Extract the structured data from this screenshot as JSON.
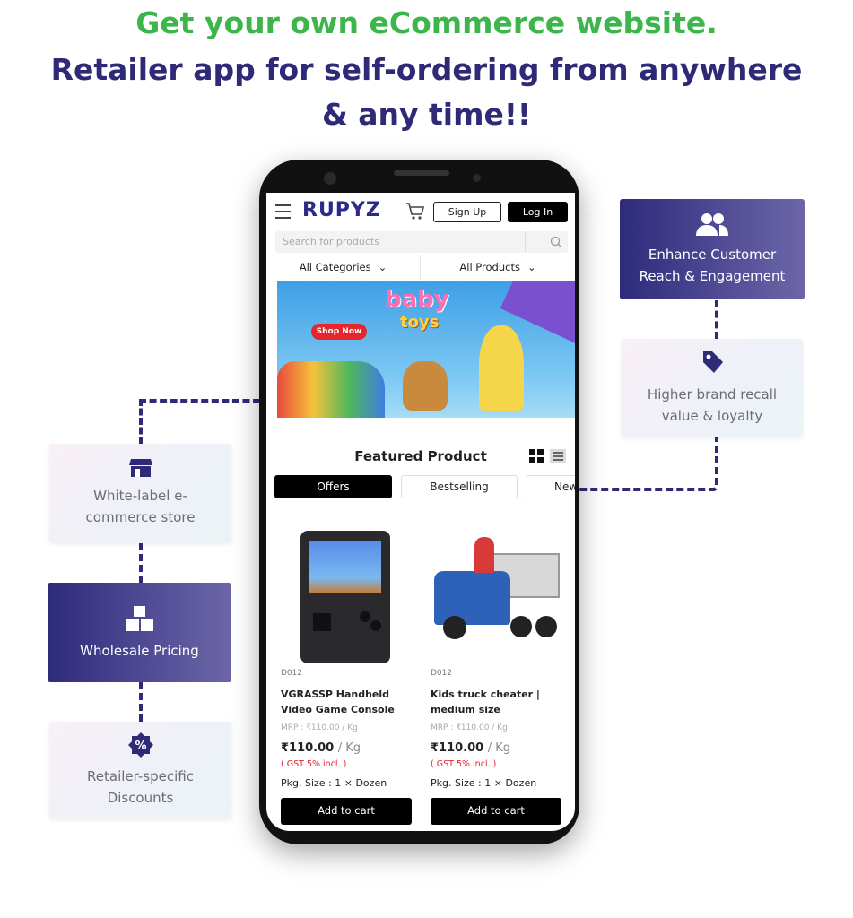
{
  "headline": {
    "line1": "Get your own eCommerce website.",
    "line2": "Retailer app for self-ordering from anywhere",
    "line3": "& any time!!"
  },
  "colors": {
    "green": "#3cb64a",
    "navy": "#2e2a78",
    "gst_red": "#e8212e"
  },
  "features": {
    "white_label": {
      "label": "White-label e-commerce store",
      "icon": "store-icon"
    },
    "wholesale": {
      "label": "Wholesale Pricing",
      "icon": "boxes-icon"
    },
    "discounts": {
      "label": "Retailer-specific Discounts",
      "icon": "percent-badge-icon"
    },
    "reach": {
      "label": "Enhance Customer Reach & Engagement",
      "icon": "users-icon"
    },
    "brand": {
      "label": "Higher brand recall value & loyalty",
      "icon": "tag-icon"
    }
  },
  "app": {
    "logo": "RUPYZ",
    "sign_up": "Sign Up",
    "log_in": "Log In",
    "search_placeholder": "Search for products",
    "categories": "All Categories",
    "products": "All Products",
    "banner": {
      "title1": "baby",
      "title2": "toys",
      "shop_now": "Shop Now"
    },
    "featured_title": "Featured Product",
    "tabs": [
      "Offers",
      "Bestselling",
      "New"
    ],
    "items": [
      {
        "code": "D012",
        "name": "VGRASSP Handheld Video Game Console",
        "mrp": "MRP : ₹110.00 / Kg",
        "price": "₹110.00",
        "unit": "/ Kg",
        "gst": "( GST 5% incl. )",
        "pkg": "Pkg. Size : 1 × Dozen",
        "cta": "Add to cart"
      },
      {
        "code": "D012",
        "name": "Kids truck cheater | medium size",
        "mrp": "MRP : ₹110.00 / Kg",
        "price": "₹110.00",
        "unit": "/ Kg",
        "gst": "( GST 5% incl. )",
        "pkg": "Pkg. Size : 1 × Dozen",
        "cta": "Add to cart"
      }
    ]
  }
}
